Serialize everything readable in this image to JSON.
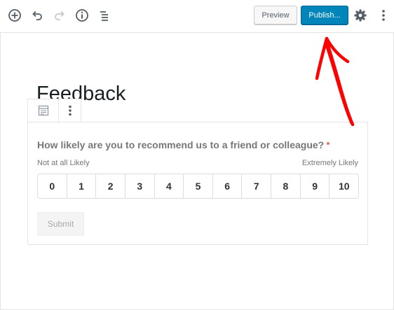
{
  "toolbar": {
    "add_icon": "plus-circle-icon",
    "undo_icon": "undo-icon",
    "redo_icon": "redo-icon",
    "info_icon": "info-icon",
    "outline_icon": "list-outline-icon",
    "preview_label": "Preview",
    "publish_label": "Publish...",
    "settings_icon": "gear-icon",
    "more_icon": "vertical-ellipsis-icon"
  },
  "editor": {
    "title": "Feedback"
  },
  "block_toolbar": {
    "block_icon": "form-block-icon",
    "more_icon": "vertical-ellipsis-icon"
  },
  "form": {
    "question": "How likely are you to recommend us to a friend or colleague?",
    "required_marker": "*",
    "scale_low_label": "Not at all Likely",
    "scale_high_label": "Extremely Likely",
    "scale": [
      "0",
      "1",
      "2",
      "3",
      "4",
      "5",
      "6",
      "7",
      "8",
      "9",
      "10"
    ],
    "submit_label": "Submit"
  },
  "colors": {
    "publish_bg": "#0085ba",
    "annotation_arrow": "#ff0000",
    "required": "#cc3333"
  }
}
